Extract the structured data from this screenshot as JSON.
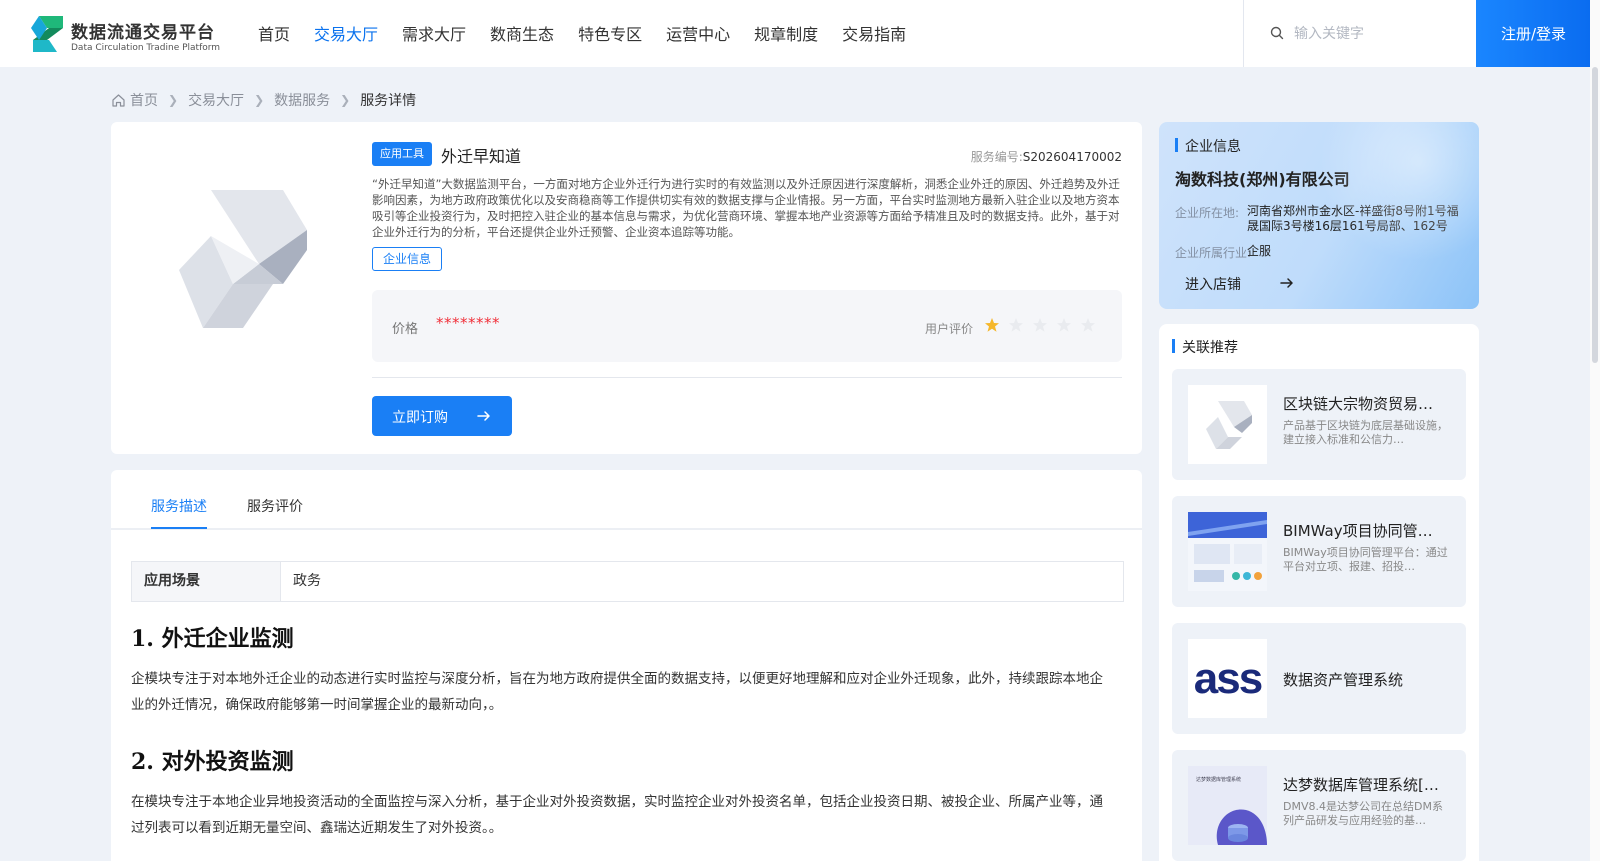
{
  "header": {
    "logo_title": "数据流通交易平台",
    "logo_subtitle": "Data Circulation Tradine Platform",
    "nav": [
      "首页",
      "交易大厅",
      "需求大厅",
      "数商生态",
      "特色专区",
      "运营中心",
      "规章制度",
      "交易指南"
    ],
    "active_nav": "交易大厅",
    "search_placeholder": "输入关键字",
    "login_label": "注册/登录",
    "accent_color": "#0a72ee"
  },
  "breadcrumb": [
    "首页",
    "交易大厅",
    "数据服务",
    "服务详情"
  ],
  "product": {
    "tag": "应用工具",
    "title": "外迁早知道",
    "service_no_label": "服务编号:",
    "service_no": "S202604170002",
    "description": "“外迁早知道”大数据监测平台，一方面对地方企业外迁行为进行实时的有效监测以及外迁原因进行深度解析，洞悉企业外迁的原因、外迁趋势及外迁影响因素，为地方政府政策优化以及安商稳商等工作提供切实有效的数据支撑与企业情报。另一方面，平台实时监测地方最新入驻企业以及地方资本吸引等企业投资行为，及时把控入驻企业的基本信息与需求，为优化营商环境、掌握本地产业资源等方面给予精准且及时的数据支持。此外，基于对企业外迁行为的分析，平台还提供企业外迁预警、企业资本追踪等功能。",
    "company_button": "企业信息",
    "price_label": "价格",
    "price_value": "********",
    "rating_label": "用户评价",
    "rating": 1,
    "rating_max": 5,
    "order_button": "立即订购"
  },
  "detail": {
    "tabs": [
      "服务描述",
      "服务评价"
    ],
    "active_tab": "服务描述",
    "scene_label": "应用场景",
    "scene_value": "政务",
    "sections": [
      {
        "heading": "1. 外迁企业监测",
        "text": "企模块专注于对本地外迁企业的动态进行实时监控与深度分析，旨在为地方政府提供全面的数据支持，以便更好地理解和应对企业外迁现象，此外，持续跟踪本地企业的外迁情况，确保政府能够第一时间掌握企业的最新动向，。"
      },
      {
        "heading": "2. 对外投资监测",
        "text": "在模块专注于本地企业异地投资活动的全面监控与深入分析，基于企业对外投资数据，实时监控企业对外投资名单，包括企业投资日期、被投企业、所属产业等，通过列表可以看到近期无量空间、鑫瑞达近期发生了对外投资。。"
      }
    ]
  },
  "company": {
    "heading": "企业信息",
    "name": "淘数科技(郑州)有限公司",
    "location_label": "企业所在地:",
    "location_value": "河南省郑州市金水区-祥盛街8号附1号福晟国际3号楼16层161号局部、162号",
    "industry_label": "企业所属行业:",
    "industry_value": "企服",
    "shop_link": "进入店铺"
  },
  "recommendations": {
    "heading": "关联推荐",
    "items": [
      {
        "title": "区块链大宗物资贸易…",
        "desc": "产品基于区块链为底层基础设施，建立接入标准和公信力…",
        "thumb_text": ""
      },
      {
        "title": "BIMWay项目协同管…",
        "desc": "BIMWay项目协同管理平台：通过平台对立项、报建、招投…",
        "thumb_text": ""
      },
      {
        "title": "数据资产管理系统",
        "desc": "",
        "thumb_text": "ass"
      },
      {
        "title": "达梦数据库管理系统[…",
        "desc": "DMV8.4是达梦公司在总结DM系列产品研发与应用经验的基…",
        "thumb_text": "达梦数据库管理系统"
      }
    ]
  }
}
